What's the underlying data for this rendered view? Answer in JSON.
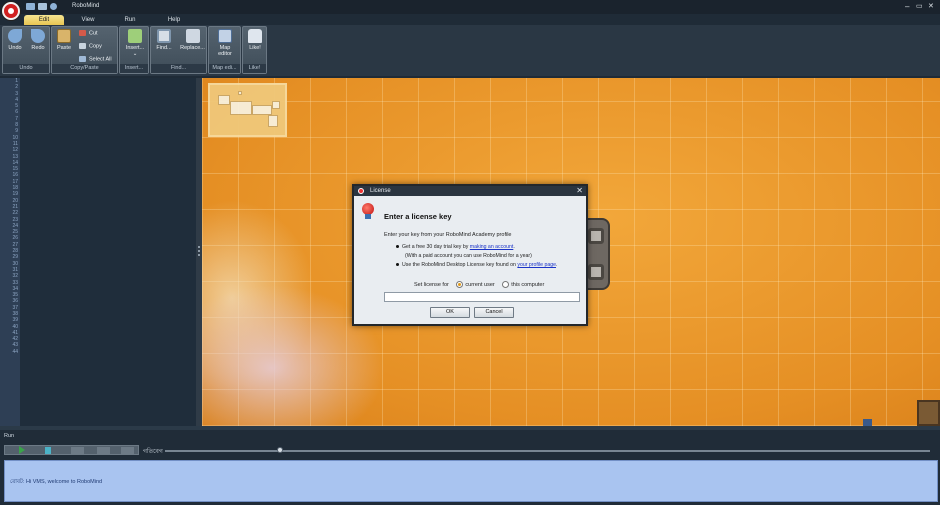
{
  "window": {
    "title": "RoboMind",
    "minimize": "–",
    "restore": "▭",
    "close": "✕"
  },
  "menu": {
    "tabs": [
      "Edit",
      "View",
      "Run",
      "Help"
    ]
  },
  "ribbon": {
    "groups": {
      "undo": {
        "label": "Undo",
        "undo": "Undo",
        "redo": "Redo"
      },
      "copypaste": {
        "label": "Copy/Paste",
        "paste": "Paste",
        "cut": "Cut",
        "copy": "Copy",
        "select_all": "Select All"
      },
      "insert": {
        "label": "Insert...",
        "insert": "Insert...",
        "insert_arrow": "⌄"
      },
      "find": {
        "label": "Find...",
        "find": "Find...",
        "replace": "Replace..."
      },
      "map": {
        "label": "Map edi...",
        "map_editor_1": "Map",
        "map_editor_2": "editor"
      },
      "like": {
        "label": "Like!",
        "like": "Like!"
      }
    }
  },
  "editor": {
    "line_count": 44
  },
  "dialog": {
    "title": "License",
    "heading": "Enter a license key",
    "intro": "Enter your key from your RoboMind Academy profile",
    "bullet1_pre": "Get a free 30 day trial key by ",
    "bullet1_link": "making an account",
    "bullet1_post": ".",
    "bullet1_note": "(With a paid account you can use RoboMind for a year)",
    "bullet2_pre": "Use the RoboMind Desktop License key found on ",
    "bullet2_link": "your profile page",
    "bullet2_post": ".",
    "set_license_for": "Set license for",
    "option_current_user": "current user",
    "option_this_computer": "this computer",
    "selected_option": "current user",
    "key_value": "",
    "ok": "OK",
    "cancel": "Cancel"
  },
  "run_panel": {
    "label": "Run",
    "speed_label": "গতিবেগ",
    "speed_value": 0.15,
    "message": "রোবট: Hi VMS, welcome to RoboMind"
  },
  "colors": {
    "accent_tab": "#f0d773",
    "message_bg": "#a9c4f0",
    "map_sand": "#e8962a"
  }
}
